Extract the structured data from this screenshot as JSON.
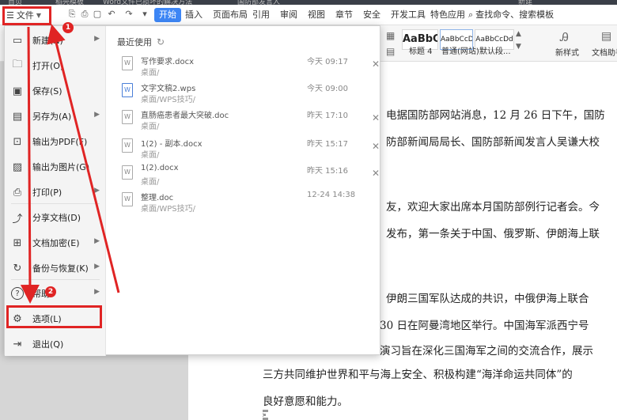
{
  "tabbar": {
    "tab1": "首页",
    "tab2": "稻壳模板",
    "tab3": "Word文件已损坏的解决方法",
    "tab4": "国防部发言人",
    "tab5": "新建"
  },
  "menu": {
    "file_label": "文件",
    "tabs": [
      "开始",
      "插入",
      "页面布局",
      "引用",
      "审阅",
      "视图",
      "章节",
      "安全",
      "开发工具",
      "特色应用"
    ],
    "search_label": "查找命令、搜索模板"
  },
  "ribbon": {
    "styles": [
      {
        "preview": "AaBbC",
        "label": "标题 4"
      },
      {
        "preview": "AaBbCcD",
        "label": "普通(网站)"
      },
      {
        "preview": "AaBbCcDd",
        "label": "默认段..."
      }
    ],
    "new_style": "新样式",
    "doc_assistant": "文档助手"
  },
  "file_menu": {
    "items": [
      {
        "label": "新建(N)",
        "icon": "new-icon",
        "submenu": true,
        "badge": "1"
      },
      {
        "label": "打开(O)",
        "icon": "open-folder-icon",
        "submenu": false
      },
      {
        "label": "保存(S)",
        "icon": "save-icon",
        "submenu": false
      },
      {
        "label": "另存为(A)",
        "icon": "save-as-icon",
        "submenu": true
      },
      {
        "label": "输出为PDF(F)",
        "icon": "pdf-icon",
        "submenu": false
      },
      {
        "label": "输出为图片(G)",
        "icon": "image-icon",
        "submenu": false
      },
      {
        "label": "打印(P)",
        "icon": "print-icon",
        "submenu": true
      },
      {
        "label": "分享文档(D)",
        "icon": "share-icon",
        "submenu": false
      },
      {
        "label": "文档加密(E)",
        "icon": "lock-icon",
        "submenu": true
      },
      {
        "label": "备份与恢复(K)",
        "icon": "backup-icon",
        "submenu": true
      },
      {
        "label": "帮助",
        "icon": "help-icon",
        "submenu": true,
        "badge": "2"
      },
      {
        "label": "选项(L)",
        "icon": "gear-icon",
        "submenu": false
      },
      {
        "label": "退出(Q)",
        "icon": "exit-icon",
        "submenu": false
      }
    ],
    "recent_title": "最近使用",
    "recent": [
      {
        "name": "写作要求.docx",
        "path": "桌面/",
        "time": "今天 09:17",
        "type": "W"
      },
      {
        "name": "文字文稿2.wps",
        "path": "桌面/WPS技巧/",
        "time": "今天 09:00",
        "type": "wps"
      },
      {
        "name": "直肠癌患者最大突破.doc",
        "path": "桌面/",
        "time": "昨天 17:10",
        "type": "W"
      },
      {
        "name": "1(2) - 副本.docx",
        "path": "桌面/",
        "time": "昨天 15:17",
        "type": "W"
      },
      {
        "name": "1(2).docx",
        "path": "桌面/",
        "time": "昨天 15:16",
        "type": "W"
      },
      {
        "name": "整理.doc",
        "path": "桌面/WPS技巧/",
        "time": "12-24 14:38",
        "type": "W"
      }
    ]
  },
  "document": {
    "lines": [
      "电据国防部网站消息，12 月 26 日下午，国防",
      "防部新闻局局长、国防部新闻发言人吴谦大校",
      "友，欢迎大家出席本月国防部例行记者会。今",
      "发布，第一条关于中国、俄罗斯、伊朗海上联",
      "伊朗三国军队达成的共识，中俄伊海上联合",
      "30 日在阿曼湾地区举行。中国海军派西宁号",
      "演习旨在深化三国海军之间的交流合作，展示",
      "三方共同维护世界和平与海上安全、积极构建“海洋命运共同体”的",
      "良好意愿和能力。"
    ]
  },
  "annotations": {
    "step1": "1",
    "step2": "2"
  },
  "colors": {
    "accent": "#3d86f5",
    "annotation_red": "#e02424"
  }
}
